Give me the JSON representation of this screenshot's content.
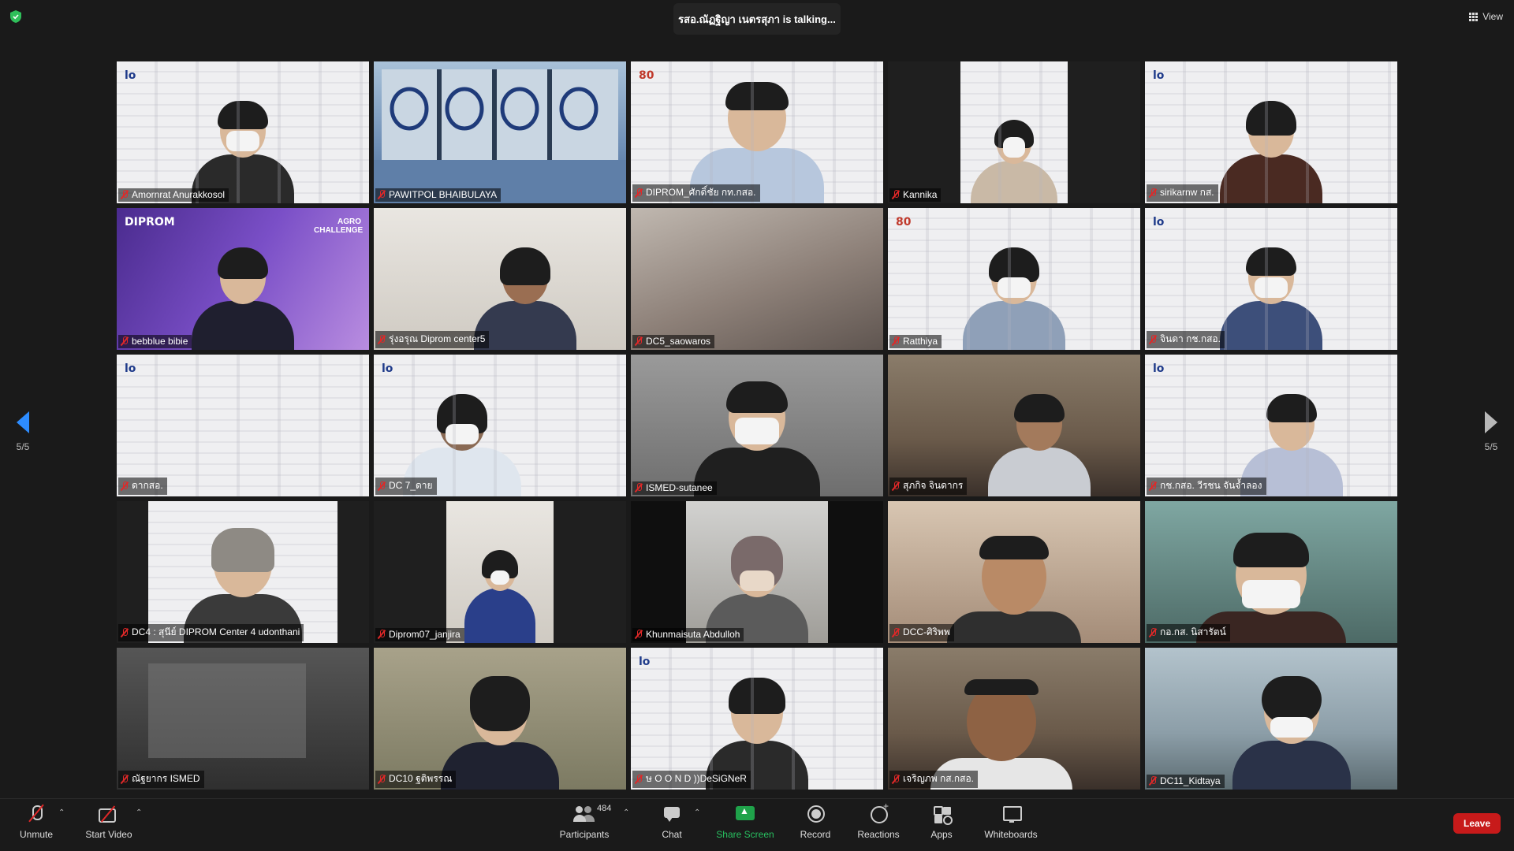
{
  "top": {
    "talking_text": "รสอ.ณัฏฐิญา เนตรสุภา is talking...",
    "view_label": "View"
  },
  "pager": {
    "left_label": "5/5",
    "right_label": "5/5"
  },
  "tiles": [
    {
      "name": "Amornrat Anurakkosol"
    },
    {
      "name": "PAWITPOL BHAIBULAYA"
    },
    {
      "name": "DIPROM_ศักดิ์ชัย กท.กสอ."
    },
    {
      "name": "Kannika"
    },
    {
      "name": "sirikarnw กส."
    },
    {
      "name": "bebblue bibie"
    },
    {
      "name": "รุ่งอรุณ Diprom center5"
    },
    {
      "name": "DC5_saowaros"
    },
    {
      "name": "Ratthiya"
    },
    {
      "name": "จินดา กช.กสอ."
    },
    {
      "name": "ดากสอ."
    },
    {
      "name": "DC 7_ดาย"
    },
    {
      "name": "ISMED-sutanee"
    },
    {
      "name": "สุภกิจ จินดากร"
    },
    {
      "name": "กช.กสอ. วีรชน จันจ้ำลอง"
    },
    {
      "name": "DC4 : สุนีย์ DIPROM Center 4 udonthani"
    },
    {
      "name": "Diprom07_janjira"
    },
    {
      "name": "Khunmaisuta Abdulloh"
    },
    {
      "name": "DCC-ศิริพพ"
    },
    {
      "name": "กอ.กส. นิสารัตน์"
    },
    {
      "name": "ณัฐยากร ISMED"
    },
    {
      "name": "DC10 ฐติพรรณ"
    },
    {
      "name": "ษ O O N D ))DeSiGNeR"
    },
    {
      "name": "เจริญภพ กส.กสอ."
    },
    {
      "name": "DC11_Kidtaya"
    }
  ],
  "tile_decor": {
    "logo_mark": "lo",
    "logo_80": "80",
    "agro_text": "AGRO CHALLENGE",
    "diprom_text": "DIPROM"
  },
  "toolbar": {
    "unmute_label": "Unmute",
    "start_video_label": "Start Video",
    "participants_label": "Participants",
    "participants_count": "484",
    "chat_label": "Chat",
    "share_label": "Share Screen",
    "record_label": "Record",
    "reactions_label": "Reactions",
    "apps_label": "Apps",
    "whiteboards_label": "Whiteboards",
    "leave_label": "Leave"
  },
  "colors": {
    "accent_blue": "#2d8cff",
    "share_green": "#1fa24a",
    "leave_red": "#c71a1a",
    "mute_red": "#e02828"
  }
}
